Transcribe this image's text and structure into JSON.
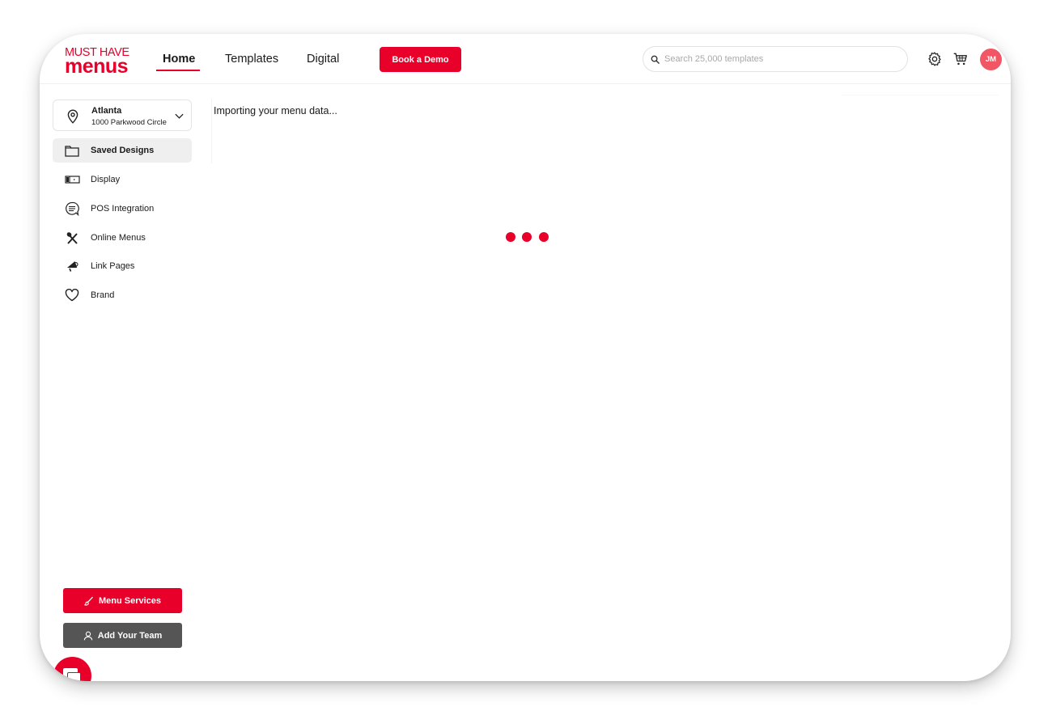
{
  "brand": {
    "logo_top": "MUST HAVE",
    "logo_bottom": "menus",
    "accent_color": "#e8002a"
  },
  "nav": {
    "home": "Home",
    "templates": "Templates",
    "digital": "Digital",
    "demo_button": "Book a Demo"
  },
  "search": {
    "placeholder": "Search 25,000 templates",
    "icon": "search-icon"
  },
  "header_icons": [
    "gear-icon",
    "cart-icon"
  ],
  "user": {
    "initials": "JM",
    "avatar_color": "#f25563"
  },
  "location": {
    "city": "Atlanta",
    "address": "1000 Parkwood Circle"
  },
  "sidebar": {
    "items": [
      {
        "label": "Saved Designs",
        "icon": "folder-icon",
        "active": true
      },
      {
        "label": "Display",
        "icon": "display-icon",
        "active": false
      },
      {
        "label": "POS Integration",
        "icon": "pos-icon",
        "active": false
      },
      {
        "label": "Online Menus",
        "icon": "utensils-icon",
        "active": false
      },
      {
        "label": "Link Pages",
        "icon": "megaphone-icon",
        "active": false
      },
      {
        "label": "Brand",
        "icon": "heart-icon",
        "active": false
      }
    ],
    "menu_services": "Menu Services",
    "add_team": "Add Your Team"
  },
  "main": {
    "status": "Importing your menu data..."
  }
}
